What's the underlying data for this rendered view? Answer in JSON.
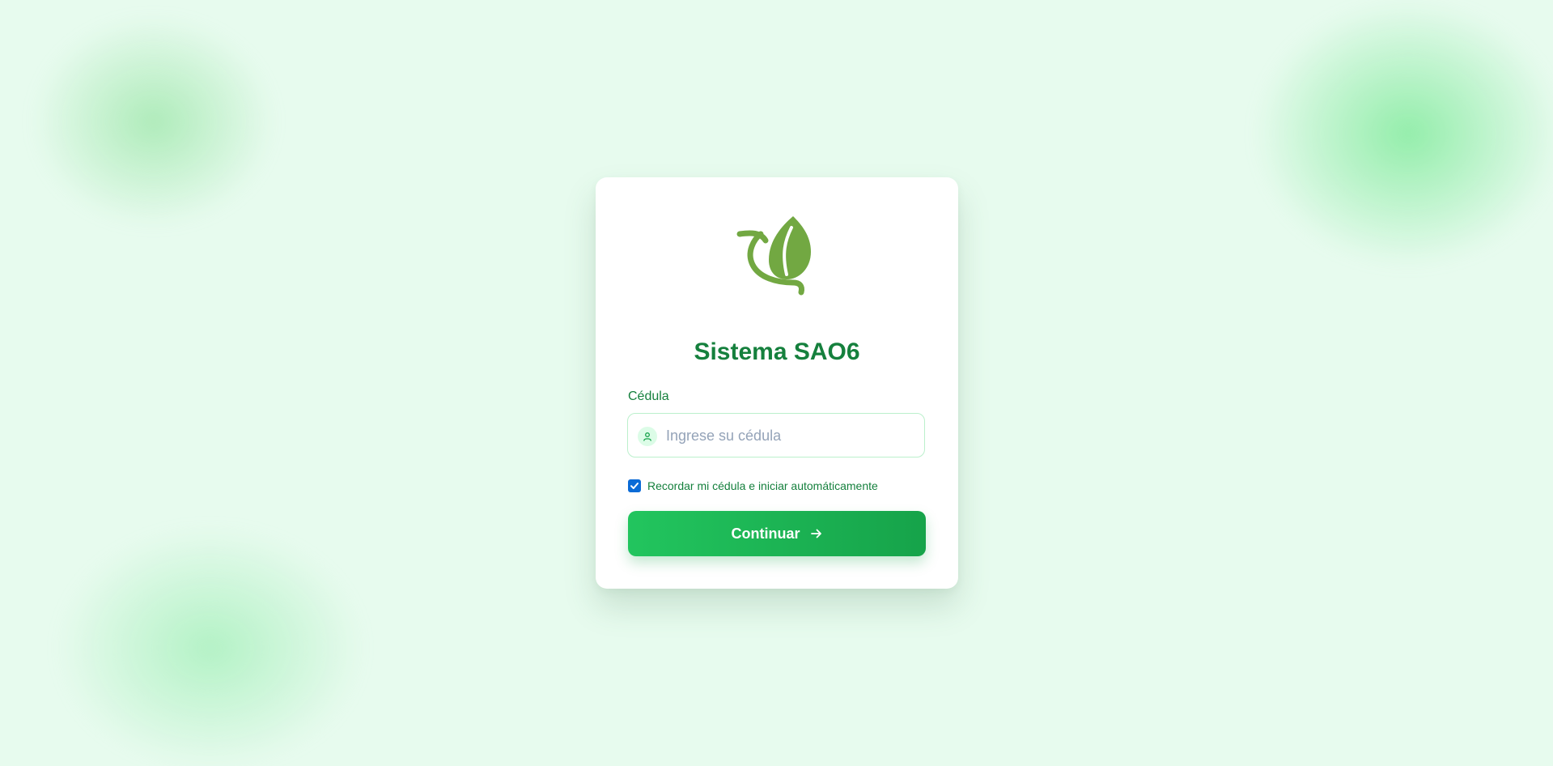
{
  "app": {
    "title": "Sistema SAO6",
    "logo_icon": "leaf-icon",
    "brand_color": "#15803d",
    "logo_color": "#72a842"
  },
  "form": {
    "field_label": "Cédula",
    "input": {
      "value": "",
      "placeholder": "Ingrese su cédula",
      "icon": "user-icon"
    },
    "remember": {
      "label": "Recordar mi cédula e iniciar automáticamente",
      "checked": true
    },
    "submit": {
      "label": "Continuar",
      "icon": "arrow-right-icon",
      "gradient": [
        "#22c55e",
        "#16a34a"
      ]
    }
  }
}
